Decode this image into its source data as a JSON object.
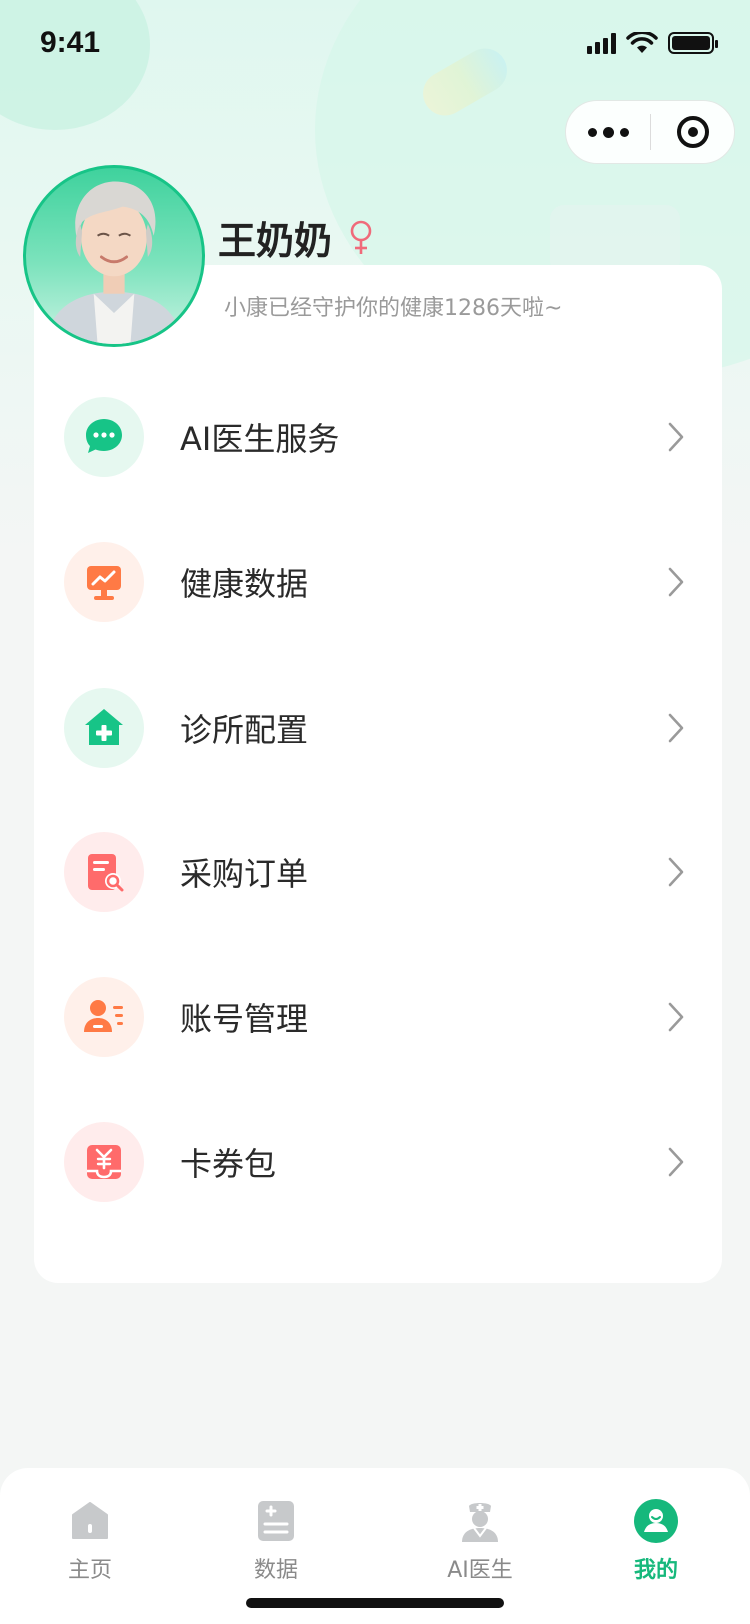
{
  "status_bar": {
    "time": "9:41"
  },
  "capsule": {
    "more_icon": "more-dots-icon",
    "close_icon": "target-icon"
  },
  "profile": {
    "name": "王奶奶",
    "gender_icon": "female-icon",
    "subtitle": "小康已经守护你的健康1286天啦~"
  },
  "menu": {
    "items": [
      {
        "label": "AI医生服务",
        "icon": "chat-bubble-icon",
        "icon_color": "#17c487",
        "bg_color": "#e6f8f0"
      },
      {
        "label": "健康数据",
        "icon": "chart-monitor-icon",
        "icon_color": "#ff7a45",
        "bg_color": "#fff0ea"
      },
      {
        "label": "诊所配置",
        "icon": "clinic-house-icon",
        "icon_color": "#17c487",
        "bg_color": "#e6f8f0"
      },
      {
        "label": "采购订单",
        "icon": "order-search-icon",
        "icon_color": "#ff6b6b",
        "bg_color": "#ffecec"
      },
      {
        "label": "账号管理",
        "icon": "account-list-icon",
        "icon_color": "#ff7a45",
        "bg_color": "#fff0ea"
      },
      {
        "label": "卡券包",
        "icon": "coupon-wallet-icon",
        "icon_color": "#ff6b6b",
        "bg_color": "#ffecec"
      }
    ]
  },
  "tab_bar": {
    "tabs": [
      {
        "label": "主页",
        "icon": "home-icon",
        "active": false
      },
      {
        "label": "数据",
        "icon": "data-clipboard-icon",
        "active": false
      },
      {
        "label": "AI医生",
        "icon": "doctor-icon",
        "active": false
      },
      {
        "label": "我的",
        "icon": "profile-icon",
        "active": true
      }
    ]
  },
  "colors": {
    "accent": "#16b87c",
    "inactive": "#8a8a8a"
  }
}
